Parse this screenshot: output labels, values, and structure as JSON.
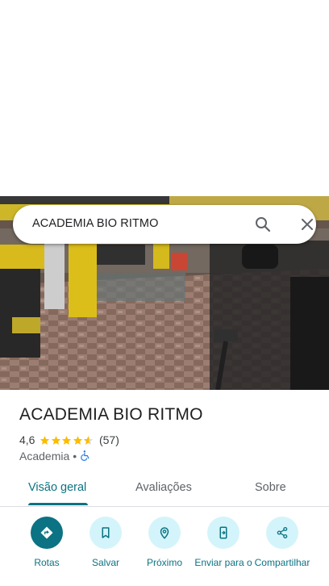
{
  "search": {
    "query": "ACADEMIA BIO RITMO"
  },
  "place": {
    "name": "ACADEMIA BIO RITMO",
    "rating": "4,6",
    "rating_value": 4.6,
    "review_count": "(57)",
    "category": "Academia",
    "separator": "•"
  },
  "tabs": [
    {
      "label": "Visão geral",
      "active": true
    },
    {
      "label": "Avaliações",
      "active": false
    },
    {
      "label": "Sobre",
      "active": false
    }
  ],
  "actions": [
    {
      "label": "Rotas",
      "icon": "directions-icon"
    },
    {
      "label": "Salvar",
      "icon": "bookmark-icon"
    },
    {
      "label": "Próximo",
      "icon": "nearby-icon"
    },
    {
      "label": "Enviar para o",
      "icon": "send-to-phone-icon"
    },
    {
      "label": "Compartilhar",
      "icon": "share-icon"
    }
  ],
  "colors": {
    "accent": "#0b7383",
    "accent_light": "#d3f4fa",
    "star": "#fbbc04",
    "accessibility": "#1a73e8"
  }
}
